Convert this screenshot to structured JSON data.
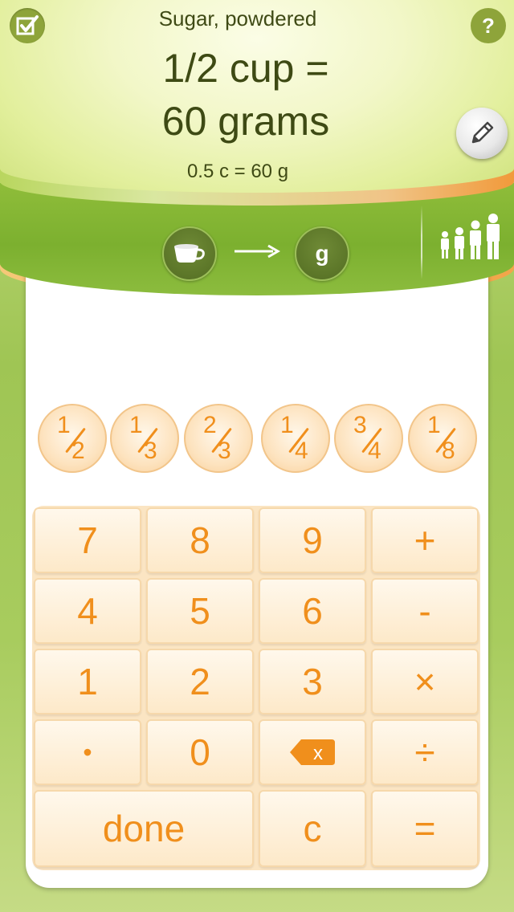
{
  "header": {
    "food_name": "Sugar, powdered",
    "result_line1": "1/2 cup =",
    "result_line2": "60 grams",
    "short_result": "0.5 c = 60 g",
    "help_label": "?"
  },
  "units": {
    "from_icon": "cup-icon",
    "to_label": "g",
    "arrow_icon": "arrow-right-icon",
    "people_icon": "people-scale-icon"
  },
  "fractions": [
    {
      "num": "1",
      "den": "2"
    },
    {
      "num": "1",
      "den": "3"
    },
    {
      "num": "2",
      "den": "3"
    },
    {
      "num": "1",
      "den": "4"
    },
    {
      "num": "3",
      "den": "4"
    },
    {
      "num": "1",
      "den": "8"
    }
  ],
  "keypad": {
    "k7": "7",
    "k8": "8",
    "k9": "9",
    "plus": "+",
    "k4": "4",
    "k5": "5",
    "k6": "6",
    "minus": "-",
    "k1": "1",
    "k2": "2",
    "k3": "3",
    "times": "×",
    "dot": "•",
    "k0": "0",
    "divide": "÷",
    "done": "done",
    "clear": "c",
    "equals": "=",
    "backspace_label": "x"
  },
  "colors": {
    "accent_orange": "#f08f1c",
    "header_text": "#3e4a14",
    "bar_green": "#7cb02f"
  }
}
